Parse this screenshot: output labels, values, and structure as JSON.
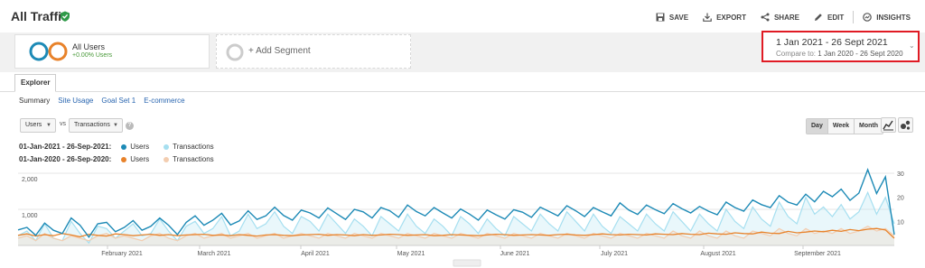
{
  "header": {
    "title": "All Traffic",
    "actions": [
      {
        "label": "SAVE",
        "icon": "save-icon"
      },
      {
        "label": "EXPORT",
        "icon": "export-icon"
      },
      {
        "label": "SHARE",
        "icon": "share-icon"
      },
      {
        "label": "EDIT",
        "icon": "edit-icon"
      },
      {
        "label": "INSIGHTS",
        "icon": "insights-icon"
      }
    ]
  },
  "segments": {
    "primary": {
      "name": "All Users",
      "change": "+0.00% Users"
    },
    "add_label": "+ Add Segment"
  },
  "date_range": {
    "main": "1 Jan 2021 - 26 Sept 2021",
    "compare_prefix": "Compare to:",
    "compare_value": "1 Jan 2020 - 26 Sept 2020"
  },
  "tabs": {
    "explorer": "Explorer"
  },
  "subtabs": [
    "Summary",
    "Site Usage",
    "Goal Set 1",
    "E-commerce"
  ],
  "controls": {
    "metric1": "Users",
    "vs": "vs",
    "metric2": "Transactions",
    "help": "?",
    "periods": [
      "Day",
      "Week",
      "Month"
    ],
    "active_period": "Day"
  },
  "legend": {
    "row1": {
      "period": "01-Jan-2021 - 26-Sep-2021:",
      "s1": "Users",
      "s2": "Transactions"
    },
    "row2": {
      "period": "01-Jan-2020 - 26-Sep-2020:",
      "s1": "Users",
      "s2": "Transactions"
    }
  },
  "colors": {
    "users_current": "#1d8ab6",
    "transactions_current": "#a6dff0",
    "users_previous": "#e8822a",
    "transactions_previous": "#f3cdb0",
    "highlight_border": "#e01b24"
  },
  "chart_data": {
    "type": "line",
    "y_left_ticks": [
      "2,000",
      "1,000"
    ],
    "y_right_ticks": [
      "30",
      "20",
      "10"
    ],
    "x_labels": [
      "February 2021",
      "March 2021",
      "April 2021",
      "May 2021",
      "June 2021",
      "July 2021",
      "August 2021",
      "September 2021"
    ],
    "ylim_left": [
      0,
      2000
    ],
    "ylim_right": [
      0,
      30
    ],
    "series": [
      {
        "name": "Users",
        "period": "01-Jan-2021 - 26-Sep-2021",
        "axis": "left",
        "values": [
          430,
          500,
          280,
          620,
          420,
          330,
          760,
          560,
          230,
          600,
          640,
          380,
          500,
          690,
          420,
          530,
          760,
          560,
          300,
          640,
          820,
          560,
          700,
          890,
          570,
          680,
          960,
          720,
          820,
          1060,
          830,
          700,
          980,
          900,
          760,
          1040,
          880,
          720,
          1000,
          930,
          760,
          1050,
          960,
          780,
          1120,
          940,
          820,
          1050,
          900,
          760,
          1010,
          870,
          700,
          980,
          850,
          730,
          990,
          920,
          780,
          1060,
          940,
          820,
          1100,
          960,
          800,
          1050,
          930,
          820,
          1180,
          980,
          860,
          1120,
          990,
          880,
          1160,
          1020,
          900,
          1080,
          950,
          850,
          1200,
          1050,
          950,
          1260,
          1130,
          1050,
          1380,
          1200,
          1120,
          1420,
          1210,
          1500,
          1350,
          1560,
          1250,
          1450,
          2100,
          1440,
          1900,
          300
        ]
      },
      {
        "name": "Transactions",
        "period": "01-Jan-2021 - 26-Sep-2021",
        "axis": "right",
        "values": [
          4,
          6,
          2,
          9,
          3,
          2,
          10,
          5,
          1,
          8,
          7,
          3,
          6,
          9,
          4,
          5,
          11,
          6,
          2,
          8,
          10,
          5,
          7,
          12,
          4,
          6,
          13,
          7,
          9,
          14,
          8,
          5,
          12,
          10,
          6,
          13,
          9,
          5,
          11,
          8,
          4,
          12,
          9,
          6,
          13,
          8,
          5,
          11,
          8,
          4,
          12,
          9,
          5,
          11,
          7,
          4,
          12,
          9,
          6,
          13,
          9,
          6,
          14,
          10,
          6,
          13,
          8,
          5,
          12,
          9,
          6,
          13,
          9,
          6,
          14,
          10,
          6,
          13,
          9,
          6,
          15,
          10,
          7,
          16,
          11,
          8,
          18,
          12,
          9,
          20,
          13,
          16,
          12,
          17,
          11,
          14,
          22,
          13,
          20,
          9
        ]
      },
      {
        "name": "Users",
        "period": "01-Jan-2020 - 26-Sep-2020",
        "axis": "left",
        "values": [
          280,
          320,
          260,
          300,
          270,
          330,
          290,
          240,
          310,
          280,
          260,
          320,
          300,
          270,
          290,
          310,
          280,
          300,
          270,
          290,
          300,
          310,
          280,
          290,
          270,
          300,
          280,
          260,
          290,
          300,
          280,
          270,
          290,
          300,
          310,
          280,
          300,
          290,
          270,
          300,
          280,
          290,
          310,
          300,
          280,
          290,
          300,
          270,
          280,
          300,
          290,
          280,
          270,
          290,
          310,
          300,
          280,
          290,
          300,
          290,
          280,
          300,
          310,
          290,
          280,
          300,
          320,
          300,
          290,
          310,
          300,
          290,
          320,
          310,
          300,
          330,
          310,
          300,
          340,
          320,
          310,
          350,
          330,
          320,
          370,
          340,
          330,
          390,
          350,
          370,
          400,
          380,
          420,
          390,
          440,
          410,
          450,
          470,
          430,
          200
        ]
      },
      {
        "name": "Transactions",
        "period": "01-Jan-2020 - 26-Sep-2020",
        "axis": "right",
        "values": [
          3,
          4,
          2,
          5,
          3,
          2,
          4,
          3,
          2,
          4,
          5,
          3,
          4,
          3,
          2,
          4,
          5,
          3,
          2,
          4,
          5,
          3,
          4,
          5,
          3,
          4,
          5,
          3,
          4,
          5,
          3,
          4,
          5,
          4,
          3,
          5,
          4,
          3,
          5,
          4,
          3,
          5,
          4,
          3,
          5,
          4,
          3,
          5,
          4,
          3,
          5,
          4,
          3,
          5,
          4,
          3,
          5,
          4,
          3,
          5,
          4,
          3,
          5,
          4,
          3,
          5,
          4,
          3,
          5,
          4,
          3,
          5,
          4,
          3,
          6,
          4,
          3,
          6,
          4,
          3,
          6,
          4,
          3,
          6,
          5,
          4,
          7,
          5,
          4,
          7,
          5,
          6,
          5,
          7,
          5,
          6,
          8,
          6,
          7,
          4
        ]
      }
    ]
  }
}
